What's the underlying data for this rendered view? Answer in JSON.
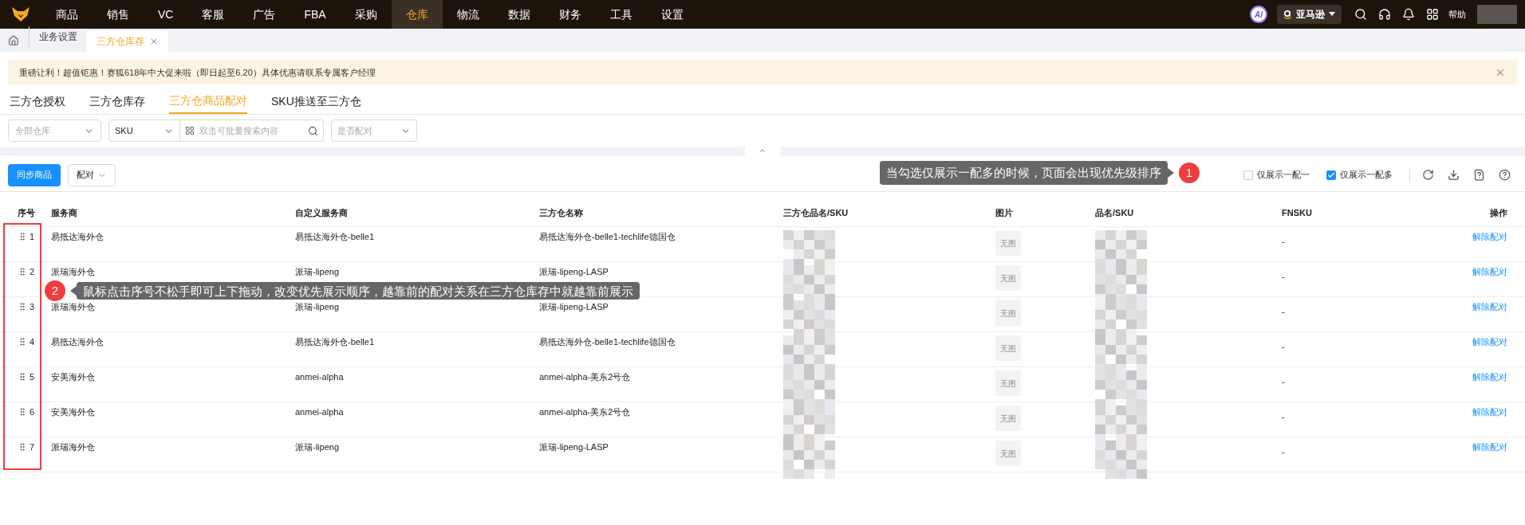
{
  "nav": {
    "items": [
      {
        "label": "商品",
        "selected": false
      },
      {
        "label": "销售",
        "selected": false
      },
      {
        "label": "VC",
        "selected": false
      },
      {
        "label": "客服",
        "selected": false
      },
      {
        "label": "广告",
        "selected": false
      },
      {
        "label": "FBA",
        "selected": false
      },
      {
        "label": "采购",
        "selected": false
      },
      {
        "label": "仓库",
        "selected": true
      },
      {
        "label": "物流",
        "selected": false
      },
      {
        "label": "数据",
        "selected": false
      },
      {
        "label": "财务",
        "selected": false
      },
      {
        "label": "工具",
        "selected": false
      },
      {
        "label": "设置",
        "selected": false
      }
    ],
    "ai_badge": "AI",
    "platform": "亚马逊",
    "help": "帮助"
  },
  "page_tabs": [
    {
      "label": "业务设置",
      "selected": false,
      "closable": false
    },
    {
      "label": "三方仓库存",
      "selected": true,
      "closable": true
    }
  ],
  "banner": {
    "text": "重磅让利！超值钜惠！赛狐618年中大促来啦（即日起至6.20）具体优惠请联系专属客户经理"
  },
  "sub_tabs": [
    {
      "label": "三方仓授权",
      "selected": false
    },
    {
      "label": "三方仓库存",
      "selected": false
    },
    {
      "label": "三方仓商品配对",
      "selected": true
    },
    {
      "label": "SKU推送至三方仓",
      "selected": false
    }
  ],
  "filters": {
    "warehouse": {
      "placeholder": "全部仓库"
    },
    "search_type": {
      "value": "SKU"
    },
    "search": {
      "placeholder": "双击可批量搜索内容"
    },
    "paired": {
      "placeholder": "是否配对"
    }
  },
  "toolbar": {
    "sync_button": "同步商品",
    "pair_button": "配对",
    "options": [
      {
        "label": "仅展示一配一",
        "checked": false
      },
      {
        "label": "仅展示一配多",
        "checked": true
      }
    ]
  },
  "table": {
    "columns": [
      "序号",
      "服务商",
      "自定义服务商",
      "三方仓名称",
      "三方仓品名/SKU",
      "图片",
      "品名/SKU",
      "FNSKU",
      "操作"
    ],
    "rows": [
      {
        "index": "1",
        "provider": "易抵达海外仓",
        "custom": "易抵达海外仓-belle1",
        "warehouse": "易抵达海外仓-belle1-techlife德国仓",
        "image": "无图",
        "fnsku": "-",
        "action": "解除配对"
      },
      {
        "index": "2",
        "provider": "派瑞海外仓",
        "custom": "派瑞-lipeng",
        "warehouse": "派瑞-lipeng-LASP",
        "image": "无图",
        "fnsku": "-",
        "action": "解除配对"
      },
      {
        "index": "3",
        "provider": "派瑞海外仓",
        "custom": "派瑞-lipeng",
        "warehouse": "派瑞-lipeng-LASP",
        "image": "无图",
        "fnsku": "-",
        "action": "解除配对"
      },
      {
        "index": "4",
        "provider": "易抵达海外仓",
        "custom": "易抵达海外仓-belle1",
        "warehouse": "易抵达海外仓-belle1-techlife德国仓",
        "image": "无图",
        "fnsku": "-",
        "action": "解除配对"
      },
      {
        "index": "5",
        "provider": "安美海外仓",
        "custom": "anmei-alpha",
        "warehouse": "anmei-alpha-美东2号仓",
        "image": "无图",
        "fnsku": "-",
        "action": "解除配对"
      },
      {
        "index": "6",
        "provider": "安美海外仓",
        "custom": "anmei-alpha",
        "warehouse": "anmei-alpha-美东2号仓",
        "image": "无图",
        "fnsku": "-",
        "action": "解除配对"
      },
      {
        "index": "7",
        "provider": "派瑞海外仓",
        "custom": "派瑞-lipeng",
        "warehouse": "派瑞-lipeng-LASP",
        "image": "无图",
        "fnsku": "-",
        "action": "解除配对"
      }
    ]
  },
  "callouts": [
    {
      "number": "1",
      "text": "当勾选仅展示一配多的时候，页面会出现优先级排序"
    },
    {
      "number": "2",
      "text": "鼠标点击序号不松手即可上下拖动，改变优先展示顺序，越靠前的配对关系在三方仓库存中就越靠前展示"
    }
  ]
}
